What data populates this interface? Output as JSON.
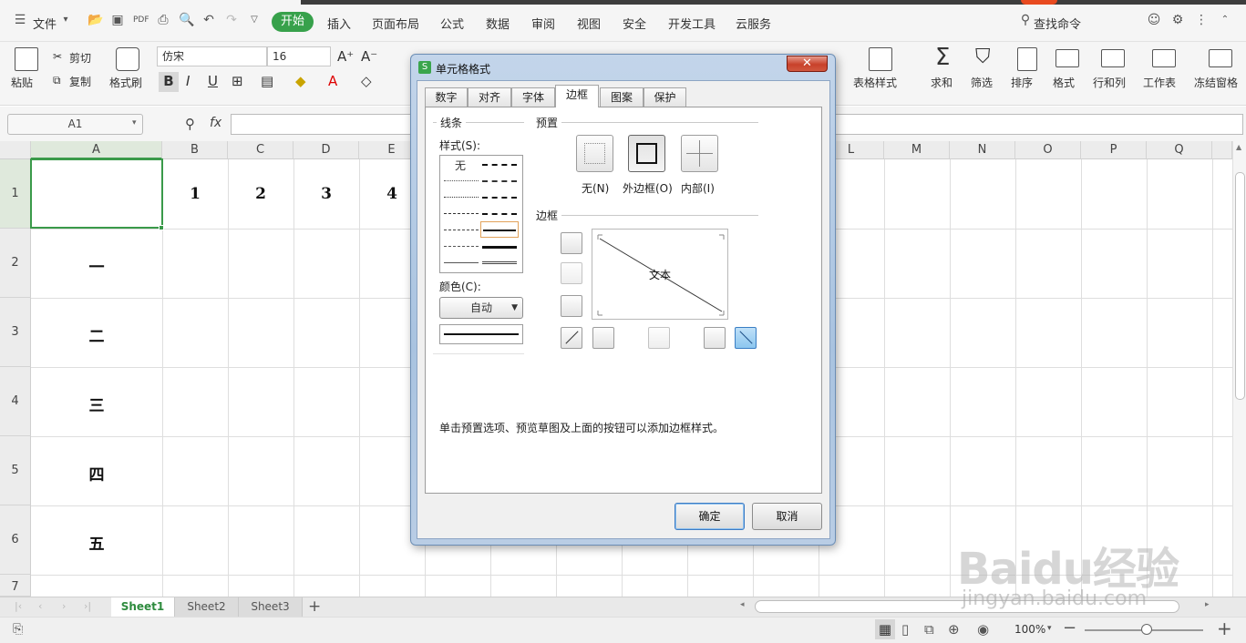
{
  "menu": {
    "file_label": "文件",
    "tabs": [
      "开始",
      "插入",
      "页面布局",
      "公式",
      "数据",
      "审阅",
      "视图",
      "安全",
      "开发工具",
      "云服务"
    ],
    "search_label": "查找命令"
  },
  "ribbon": {
    "paste": "粘贴",
    "cut": "剪切",
    "copy": "复制",
    "format_painter": "格式刷",
    "font_name": "仿宋",
    "font_size": "16",
    "table_style": "表格样式",
    "sum": "求和",
    "filter": "筛选",
    "sort": "排序",
    "format": "格式",
    "row_col": "行和列",
    "worksheet": "工作表",
    "freeze": "冻结窗格"
  },
  "formula_bar": {
    "name_box": "A1",
    "fx": "fx"
  },
  "grid": {
    "columns": [
      "A",
      "B",
      "C",
      "D",
      "E",
      "L",
      "M",
      "N",
      "O",
      "P",
      "Q"
    ],
    "rows": [
      "1",
      "2",
      "3",
      "4",
      "5",
      "6",
      "7"
    ],
    "row1": [
      "1",
      "2",
      "3",
      "4"
    ],
    "colA": [
      "一",
      "二",
      "三",
      "四",
      "五"
    ]
  },
  "sheets": {
    "tabs": [
      "Sheet1",
      "Sheet2",
      "Sheet3"
    ],
    "add": "+"
  },
  "status": {
    "zoom": "100%"
  },
  "dialog": {
    "title": "单元格格式",
    "close": "✕",
    "tabs": [
      "数字",
      "对齐",
      "字体",
      "边框",
      "图案",
      "保护"
    ],
    "line_group": "线条",
    "style_label": "样式(S):",
    "style_none": "无",
    "color_label": "颜色(C):",
    "color_value": "自动",
    "preset_group": "预置",
    "preset_none": "无(N)",
    "preset_outline": "外边框(O)",
    "preset_inside": "内部(I)",
    "border_group": "边框",
    "preview_text": "文本",
    "hint": "单击预置选项、预览草图及上面的按钮可以添加边框样式。",
    "ok": "确定",
    "cancel": "取消"
  },
  "watermark": {
    "logo": "Baidu经验",
    "url": "jingyan.baidu.com"
  }
}
